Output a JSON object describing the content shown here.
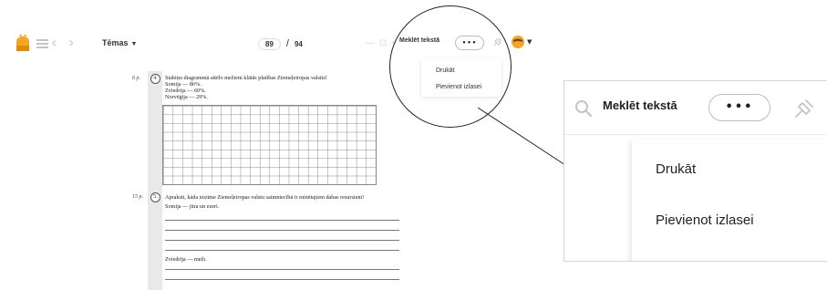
{
  "toolbar": {
    "topics_label": "Tēmas",
    "current_page": "89",
    "page_separator": "/",
    "total_pages": "94",
    "zoom_controls": "— ⊡ +",
    "search_label": "Meklēt tekstā",
    "more_label": "•••"
  },
  "dropdown": {
    "items": [
      "Drukāt",
      "Pievienot izlasei"
    ]
  },
  "document": {
    "tasks": [
      {
        "points": "6 p.",
        "number": "4.",
        "lines": [
          "Stabiņu diagrammā attēlo mežiem klātās platības Ziemeļeiropas valstīs!",
          "Somija — 86%.",
          "Zviedrija — 60%.",
          "Norvēģija — 29%."
        ]
      },
      {
        "points": "15 p.",
        "number": "5.",
        "lines": [
          "Apraksti, kāda nozīme Ziemeļeiropas valstu saimniecībā ir minētajiem dabas resursiem!",
          "Somija — jūra un ezeri."
        ],
        "sub_label": "Zviedrija — meži."
      }
    ]
  },
  "zoom_panel": {
    "search_label": "Meklēt tekstā",
    "more_label": "•••",
    "menu_items": [
      "Drukāt",
      "Pievienot izlasei"
    ]
  },
  "colors": {
    "accent": "#f5a623",
    "gutter": "#e9e9e9",
    "icon_grey": "#c4c4c4"
  },
  "icons": [
    "logo-icon",
    "menu-icon",
    "chevron-left-icon",
    "chevron-right-icon",
    "chevron-down-icon",
    "search-icon",
    "pin-icon",
    "avatar-icon"
  ]
}
